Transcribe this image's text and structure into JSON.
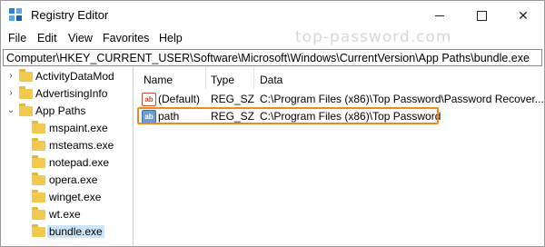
{
  "window": {
    "title": "Registry Editor"
  },
  "menu": [
    "File",
    "Edit",
    "View",
    "Favorites",
    "Help"
  ],
  "watermark": "top-password.com",
  "address": "Computer\\HKEY_CURRENT_USER\\Software\\Microsoft\\Windows\\CurrentVersion\\App Paths\\bundle.exe",
  "tree": {
    "items": [
      {
        "label": "ActivityDataMod",
        "chevron": "›"
      },
      {
        "label": "AdvertisingInfo",
        "chevron": "›"
      },
      {
        "label": "App Paths",
        "chevron": "⌄"
      },
      {
        "label": "mspaint.exe",
        "chevron": ""
      },
      {
        "label": "msteams.exe",
        "chevron": ""
      },
      {
        "label": "notepad.exe",
        "chevron": ""
      },
      {
        "label": "opera.exe",
        "chevron": ""
      },
      {
        "label": "winget.exe",
        "chevron": ""
      },
      {
        "label": "wt.exe",
        "chevron": ""
      },
      {
        "label": "bundle.exe",
        "chevron": ""
      }
    ],
    "selected": "bundle.exe"
  },
  "list": {
    "columns": [
      "Name",
      "Type",
      "Data"
    ],
    "rows": [
      {
        "icon": "ab",
        "name": "(Default)",
        "type": "REG_SZ",
        "data": "C:\\Program Files (x86)\\Top Password\\Password Recover..."
      },
      {
        "icon": "ab",
        "name": "path",
        "type": "REG_SZ",
        "data": "C:\\Program Files (x86)\\Top Password"
      }
    ]
  },
  "colors": {
    "highlight": "#f08a1c",
    "selection": "#cce4f7",
    "folder": "#f2c94c"
  }
}
